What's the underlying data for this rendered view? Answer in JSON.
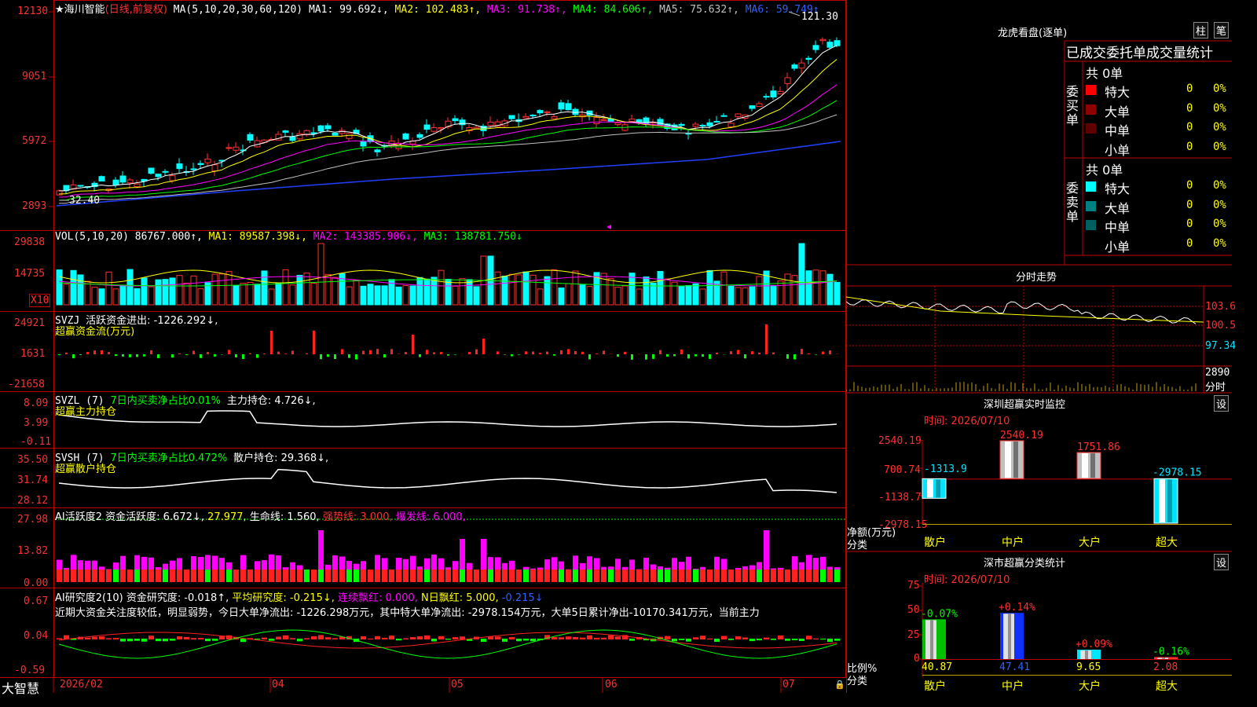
{
  "main": {
    "title_prefix": "★海川智能",
    "period": "(日线,前复权)",
    "ma_label": "MA(5,10,20,30,60,120)",
    "ma1": "MA1: 99.692↓,",
    "ma2": "MA2: 102.483↑,",
    "ma3": "MA3: 91.738↑,",
    "ma4": "MA4: 84.606↑,",
    "ma5": "MA5: 75.632↑,",
    "ma6": "MA6: 59.749↑",
    "high_label": "121.30",
    "low_label": "32.40",
    "yticks": [
      "12130",
      "9051",
      "5972",
      "2893"
    ],
    "colors": {
      "ma1": "#ffffff",
      "ma2": "#ffff00",
      "ma3": "#ff00ff",
      "ma4": "#00ff00",
      "ma5": "#c0c0c0",
      "ma6": "#2040ff",
      "up": "#ff3030",
      "down": "#00ffff"
    }
  },
  "vol": {
    "title": "VOL(5,10,20)",
    "value": "86767.000↑,",
    "ma1": "MA1: 89587.398↓,",
    "ma2": "MA2: 143385.906↓,",
    "ma3": "MA3: 138781.750↓",
    "yticks": [
      "29838",
      "14735"
    ],
    "unit": "X10"
  },
  "svzj": {
    "title": "SVZJ",
    "value": "活跃资金进出: -1226.292↓,",
    "subtitle": "超赢资金流(万元)",
    "yticks": [
      "24921",
      "1631",
      "-21658"
    ]
  },
  "svzl": {
    "title": "SVZL (7)",
    "net": "7日内买卖净占比0.01%",
    "value": "主力持仓: 4.726↓,",
    "subtitle": "超赢主力持仓",
    "yticks": [
      "8.09",
      "3.99",
      "-0.11"
    ]
  },
  "svsh": {
    "title": "SVSH (7)",
    "net": "7日内买卖净占比0.472%",
    "value": "散户持仓: 29.368↓,",
    "subtitle": "超赢散户持仓",
    "yticks": [
      "35.50",
      "31.74",
      "28.12"
    ]
  },
  "ai1": {
    "title": "AI活跃度2",
    "v1": "资金活跃度: 6.672↓,",
    "v2": "27.977,",
    "v3": "生命线: 1.560,",
    "v4": "强势线: 3.000,",
    "v5": "爆发线: 6.000,",
    "yticks": [
      "27.98",
      "13.82",
      "0.00"
    ]
  },
  "ai2": {
    "title": "AI研究度2(10)",
    "v1": "资金研究度: -0.018↑,",
    "v2": "平均研究度: -0.215↓,",
    "v3": "连续飘红: 0.000,",
    "v4": "N日飘红: 5.000,",
    "v5": "-0.215↓",
    "comment": "近期大资金关注度较低，明显弱势，今日大单净流出: -1226.298万元，其中特大单净流出: -2978.154万元，大单5日累计净出-10170.341万元，当前主力",
    "yticks": [
      "0.67",
      "0.04",
      "-0.59"
    ]
  },
  "xaxis": {
    "brand": "大智慧",
    "labels": [
      "2026/02",
      "04",
      "05",
      "06",
      "07"
    ]
  },
  "lhb": {
    "title": "龙虎看盘(逐单)",
    "btn1": "柱",
    "btn2": "笔",
    "header": "已成交委托单成交量统计",
    "buy_label": "委买单",
    "sell_label": "委卖单",
    "buy_total": "共 0单",
    "sell_total": "共 0单",
    "buy_rows": [
      {
        "name": "特大",
        "count": "0",
        "pct": "0%",
        "color": "#ff0000"
      },
      {
        "name": "大单",
        "count": "0",
        "pct": "0%",
        "color": "#900000"
      },
      {
        "name": "中单",
        "count": "0",
        "pct": "0%",
        "color": "#600000"
      },
      {
        "name": "小单",
        "count": "0",
        "pct": "0%",
        "color": ""
      }
    ],
    "sell_rows": [
      {
        "name": "特大",
        "count": "0",
        "pct": "0%",
        "color": "#00ffff"
      },
      {
        "name": "大单",
        "count": "0",
        "pct": "0%",
        "color": "#008080"
      },
      {
        "name": "中单",
        "count": "0",
        "pct": "0%",
        "color": "#006060"
      },
      {
        "name": "小单",
        "count": "0",
        "pct": "0%",
        "color": ""
      }
    ]
  },
  "fenshi": {
    "title": "分时走势",
    "yticks": [
      "103.6",
      "100.5",
      "97.34"
    ],
    "vol_tick": "2890",
    "xlabel": "分时"
  },
  "sz_monitor": {
    "title": "深圳超赢实时监控",
    "btn": "设",
    "time": "时间: 2026/07/10",
    "yticks": [
      "2540.19",
      "700.74",
      "-1138.7",
      "-2978.15"
    ],
    "ylabel1": "净额(万元)",
    "ylabel2": "分类",
    "bars": [
      {
        "cat": "散户",
        "value": -1313.9,
        "label": "-1313.9"
      },
      {
        "cat": "中户",
        "value": 2540.19,
        "label": "2540.19"
      },
      {
        "cat": "大户",
        "value": 1751.86,
        "label": "1751.86"
      },
      {
        "cat": "超大",
        "value": -2978.15,
        "label": "-2978.15"
      }
    ]
  },
  "sz_class": {
    "title": "深市超赢分类统计",
    "btn": "设",
    "time": "时间: 2026/07/10",
    "yticks": [
      "75",
      "50",
      "25",
      "0"
    ],
    "ylabel1": "比例%",
    "ylabel2": "分类",
    "bars": [
      {
        "cat": "散户",
        "value": 40.87,
        "label": "40.87",
        "chg": "-0.07%"
      },
      {
        "cat": "中户",
        "value": 47.41,
        "label": "47.41",
        "chg": "+0.14%"
      },
      {
        "cat": "大户",
        "value": 9.65,
        "label": "9.65",
        "chg": "+0.09%"
      },
      {
        "cat": "超大",
        "value": 2.08,
        "label": "2.08",
        "chg": "-0.16%"
      }
    ]
  },
  "chart_data": [
    {
      "type": "bar",
      "title": "深圳超赢实时监控",
      "categories": [
        "散户",
        "中户",
        "大户",
        "超大"
      ],
      "values": [
        -1313.9,
        2540.19,
        1751.86,
        -2978.15
      ],
      "ylabel": "净额(万元)",
      "ylim": [
        -2978.15,
        2540.19
      ]
    },
    {
      "type": "bar",
      "title": "深市超赢分类统计",
      "categories": [
        "散户",
        "中户",
        "大户",
        "超大"
      ],
      "values": [
        40.87,
        47.41,
        9.65,
        2.08
      ],
      "ylabel": "比例%",
      "ylim": [
        0,
        75
      ]
    }
  ]
}
